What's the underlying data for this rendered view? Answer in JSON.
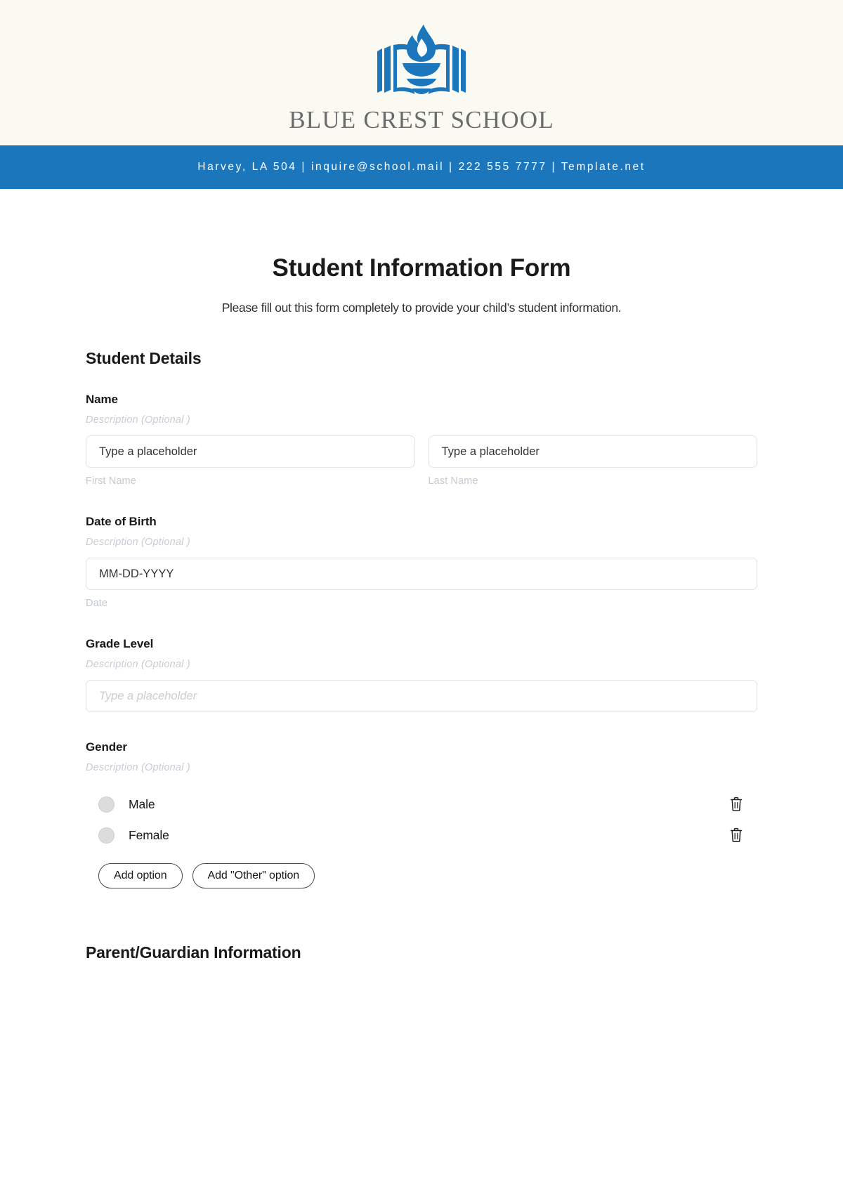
{
  "letterhead": {
    "logo_icon": "book-flame-logo-icon",
    "school_name": "BLUE CREST SCHOOL",
    "background_color": "#fafaf2"
  },
  "contact_bar": {
    "text": "Harvey, LA 504 | inquire@school.mail | 222 555 7777 | Template.net",
    "background_color": "#1c76bc",
    "text_color": "#ffffff"
  },
  "form": {
    "title": "Student Information Form",
    "subtitle": "Please fill out this form completely to provide your child’s student information.",
    "sections": [
      {
        "heading": "Student Details"
      },
      {
        "heading": "Parent/Guardian Information"
      }
    ],
    "fields": {
      "name": {
        "label": "Name",
        "description": "Description  (Optional )",
        "first_value": "Type a placeholder",
        "last_value": "Type a placeholder",
        "first_sub_label": "First Name",
        "last_sub_label": "Last Name"
      },
      "date_of_birth": {
        "label": "Date of Birth",
        "description": "Description  (Optional )",
        "value": "MM-DD-YYYY",
        "sub_label": "Date"
      },
      "grade_level": {
        "label": "Grade Level",
        "description": "Description  (Optional )",
        "placeholder": "Type a placeholder"
      },
      "gender": {
        "label": "Gender",
        "description": "Description  (Optional )",
        "options": [
          {
            "label": "Male",
            "delete_icon": "trash-icon"
          },
          {
            "label": "Female",
            "delete_icon": "trash-icon"
          }
        ],
        "add_option_label": "Add option",
        "add_other_option_label": "Add \"Other\" option"
      }
    }
  }
}
